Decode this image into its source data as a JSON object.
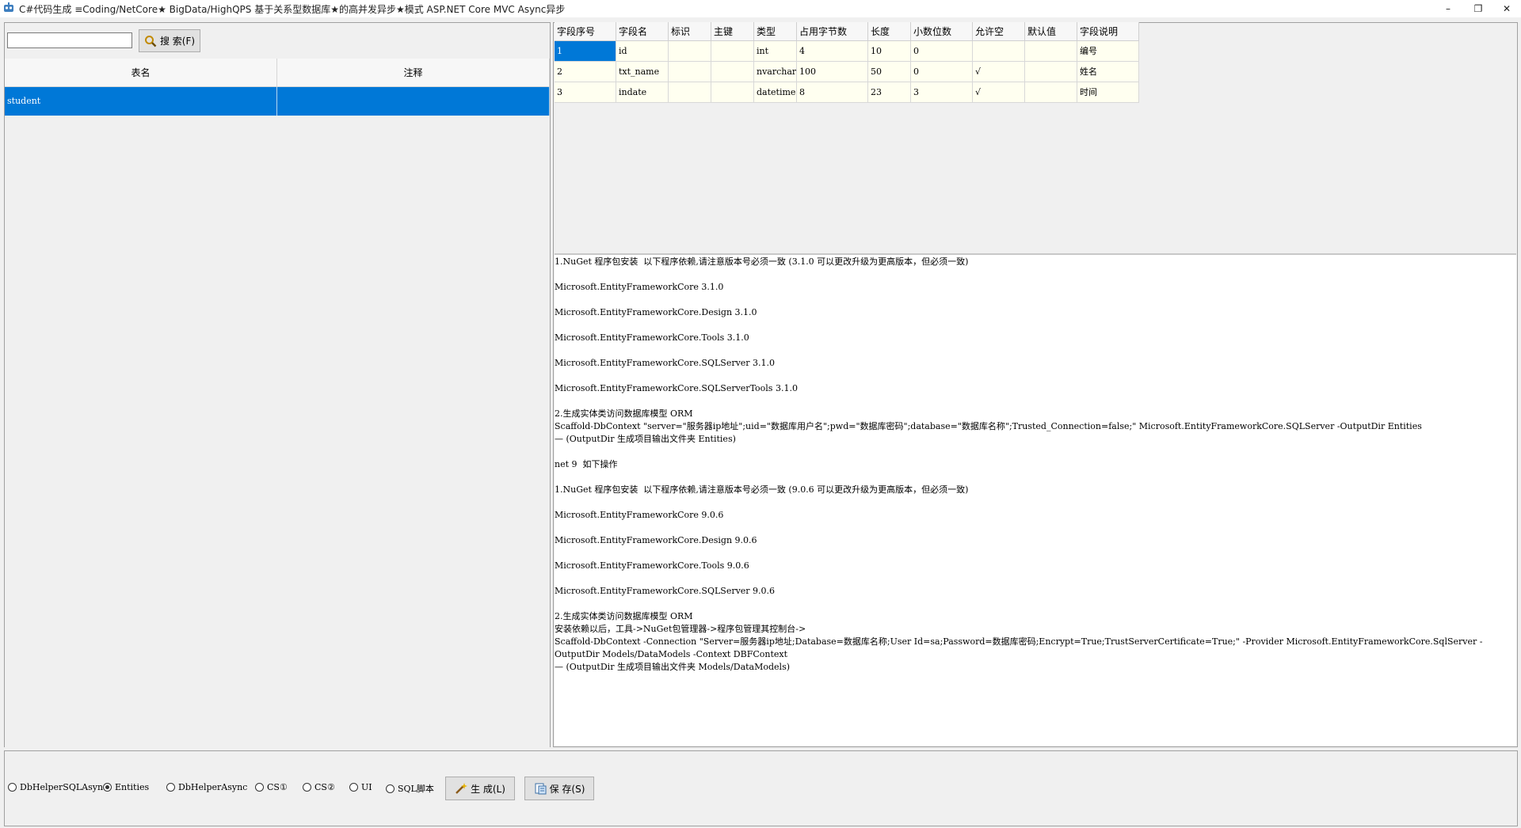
{
  "window": {
    "title": "C#代码生成 ≡Coding/NetCore★  BigData/HighQPS  基于关系型数据库★的高并发异步★模式 ASP.NET Core MVC Async异步",
    "minimize_glyph": "–",
    "restore_glyph": "❐",
    "close_glyph": "✕"
  },
  "search": {
    "value": "",
    "button_label": "搜 索(F)"
  },
  "table_list": {
    "columns": [
      "表名",
      "注释"
    ],
    "rows": [
      {
        "name": "student",
        "comment": ""
      }
    ]
  },
  "fields_grid": {
    "columns": [
      "字段序号",
      "字段名",
      "标识",
      "主键",
      "类型",
      "占用字节数",
      "长度",
      "小数位数",
      "允许空",
      "默认值",
      "字段说明"
    ],
    "rows": [
      [
        "1",
        "id",
        "",
        "",
        "int",
        "4",
        "10",
        "0",
        "",
        "",
        "编号"
      ],
      [
        "2",
        "txt_name",
        "",
        "",
        "nvarchar",
        "100",
        "50",
        "0",
        "√",
        "",
        "姓名"
      ],
      [
        "3",
        "indate",
        "",
        "",
        "datetime",
        "8",
        "23",
        "3",
        "√",
        "",
        "时间"
      ]
    ]
  },
  "code_lines": [
    "1.NuGet 程序包安装  以下程序依赖,请注意版本号必须一致 (3.1.0 可以更改升级为更高版本，但必须一致)",
    "",
    "Microsoft.EntityFrameworkCore 3.1.0",
    "",
    "Microsoft.EntityFrameworkCore.Design 3.1.0",
    "",
    "Microsoft.EntityFrameworkCore.Tools 3.1.0",
    "",
    "Microsoft.EntityFrameworkCore.SQLServer 3.1.0",
    "",
    "Microsoft.EntityFrameworkCore.SQLServerTools 3.1.0",
    "",
    "2.生成实体类访问数据库模型 ORM",
    "Scaffold-DbContext \"server=\"服务器ip地址\";uid=\"数据库用户名\";pwd=\"数据库密码\";database=\"数据库名称\";Trusted_Connection=false;\" Microsoft.EntityFrameworkCore.SQLServer -OutputDir Entities",
    "— (OutputDir 生成项目输出文件夹 Entities)",
    "",
    "net 9  如下操作",
    "",
    "1.NuGet 程序包安装  以下程序依赖,请注意版本号必须一致 (9.0.6 可以更改升级为更高版本，但必须一致)",
    "",
    "Microsoft.EntityFrameworkCore 9.0.6",
    "",
    "Microsoft.EntityFrameworkCore.Design 9.0.6",
    "",
    "Microsoft.EntityFrameworkCore.Tools 9.0.6",
    "",
    "Microsoft.EntityFrameworkCore.SQLServer 9.0.6",
    "",
    "2.生成实体类访问数据库模型 ORM",
    "安装依赖以后，工具->NuGet包管理器->程序包管理其控制台->",
    "Scaffold-DbContext -Connection \"Server=服务器ip地址;Database=数据库名称;User Id=sa;Password=数据库密码;Encrypt=True;TrustServerCertificate=True;\" -Provider Microsoft.EntityFrameworkCore.SqlServer -",
    "OutputDir Models/DataModels -Context DBFContext",
    "— (OutputDir 生成项目输出文件夹 Models/DataModels)"
  ],
  "options": [
    {
      "label": "DbHelperSQLAsyn",
      "checked": false
    },
    {
      "label": "Entities",
      "checked": true
    },
    {
      "label": "DbHelperAsync",
      "checked": false
    },
    {
      "label": "CS①",
      "checked": false
    },
    {
      "label": "CS②",
      "checked": false
    },
    {
      "label": "UI",
      "checked": false
    },
    {
      "label": "SQL脚本",
      "checked": false
    }
  ],
  "generate_button": "生 成(L)",
  "save_button": "保 存(S)",
  "colors": {
    "selection": "#0078d7",
    "cell_bg": "#fffff0"
  }
}
